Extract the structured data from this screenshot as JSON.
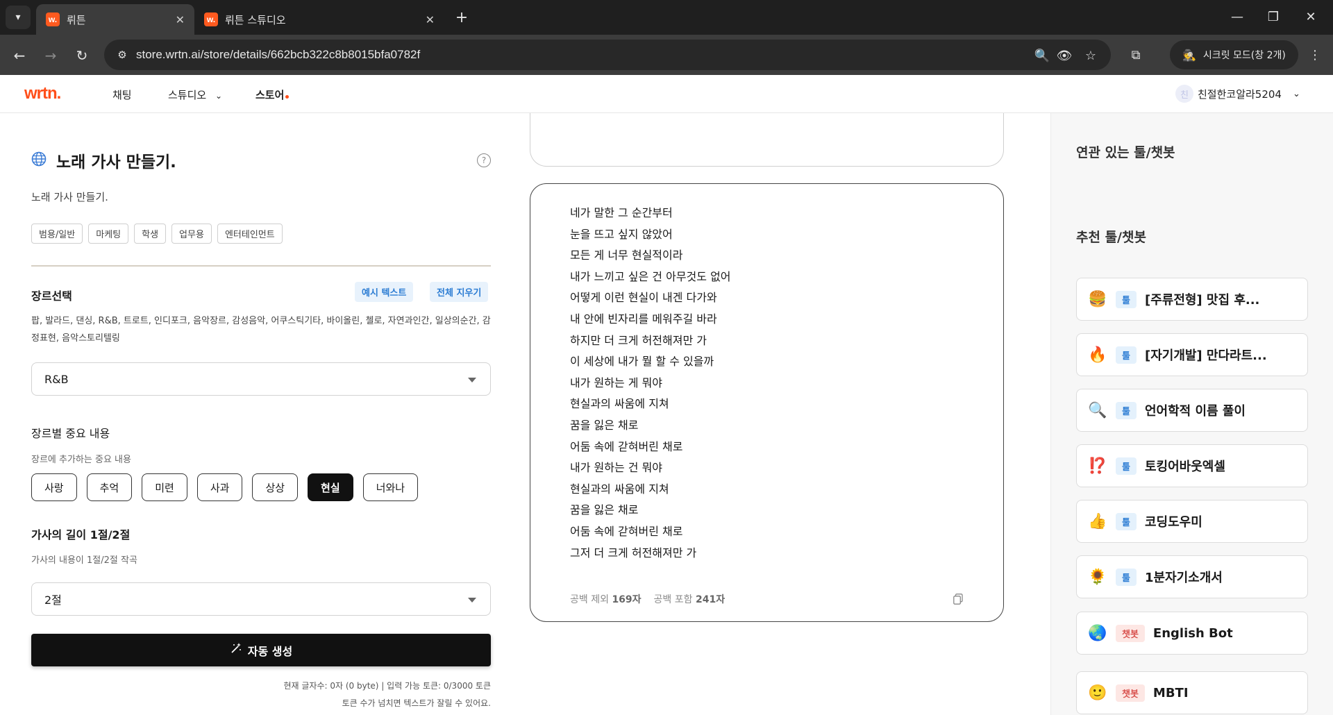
{
  "browser": {
    "tabs": [
      {
        "title": "뤼튼",
        "favicon": "w."
      },
      {
        "title": "뤼튼 스튜디오",
        "favicon": "w."
      }
    ],
    "url": "store.wrtn.ai/store/details/662bcb322c8b8015bfa0782f",
    "incognito_label": "시크릿 모드(창 2개)",
    "icons": {
      "tab_menu": "▾",
      "close": "✕",
      "new_tab": "+",
      "minimize": "—",
      "maximize": "❐",
      "win_close": "✕",
      "back": "←",
      "forward": "→",
      "reload": "↻",
      "site_info": "⚙",
      "zoom": "🔍",
      "eye_off": "👁",
      "star": "☆",
      "extensions": "⧉",
      "more": "⋮",
      "incognito": "🕵"
    }
  },
  "site": {
    "logo": "wrtn.",
    "nav": {
      "chat": "채팅",
      "studio": "스튜디오",
      "studio_caret": "⌄",
      "store": "스토어"
    },
    "user": {
      "avatar": "친",
      "name": "친절한코알라5204",
      "caret": "⌄"
    }
  },
  "tool": {
    "title": "노래 가사 만들기.",
    "description": "노래 가사 만들기.",
    "help": "?",
    "tags": [
      "범용/일반",
      "마케팅",
      "학생",
      "업무용",
      "엔터테인먼트"
    ]
  },
  "form": {
    "genre": {
      "label": "장르선택",
      "example_button": "예시 텍스트",
      "clear_button": "전체 지우기",
      "options_text": "팝, 발라드, 댄싱, R&B, 트로트, 인디포크, 음악장르, 감성음악, 어쿠스틱기타, 바이올린, 첼로, 자연과인간, 일상의순간, 감정표현, 음악스토리텔링",
      "selected": "R&B"
    },
    "content": {
      "label": "장르별 중요 내용",
      "sub": "장르에 추가하는 중요 내용",
      "chips": [
        "사랑",
        "추억",
        "미련",
        "사과",
        "상상",
        "현실",
        "너와나"
      ],
      "selected": "현실"
    },
    "length": {
      "label": "가사의 길이 1절/2절",
      "sub": "가사의 내용이 1절/2절 작곡",
      "selected": "2절"
    },
    "generate_button": "자동 생성",
    "count_line1": "현재 글자수: 0자 (0 byte)  |  입력 가능 토큰: 0/3000 토큰",
    "count_line2": "토큰 수가 넘치면 텍스트가 잘릴 수 있어요."
  },
  "result": {
    "lyrics": [
      "네가 말한 그 순간부터",
      "눈을 뜨고 싶지 않았어",
      "모든 게 너무 현실적이라",
      "내가 느끼고 싶은 건 아무것도 없어",
      "어떻게 이런 현실이 내겐 다가와",
      "내 안에 빈자리를 메워주길 바라",
      "하지만 더 크게 허전해져만 가",
      "이 세상에 내가 뭘 할 수 있을까",
      "내가 원하는 게 뭐야",
      "현실과의 싸움에 지쳐",
      "꿈을 잃은 채로",
      "어둠 속에 갇혀버린 채로",
      "내가 원하는 건 뭐야",
      "현실과의 싸움에 지쳐",
      "꿈을 잃은 채로",
      "어둠 속에 갇혀버린 채로",
      "그저 더 크게 허전해져만 가"
    ],
    "stats": {
      "no_space_label": "공백 제외",
      "no_space_value": "169자",
      "with_space_label": "공백 포함",
      "with_space_value": "241자"
    }
  },
  "sidebar": {
    "related_heading": "연관 있는 툴/챗봇",
    "recommended_heading": "추천 툴/챗봇",
    "items": [
      {
        "emoji": "🍔",
        "badge": "툴",
        "type": "tool",
        "name": "[주류전형] 맛집 후..."
      },
      {
        "emoji": "🔥",
        "badge": "툴",
        "type": "tool",
        "name": "[자기개발] 만다라트..."
      },
      {
        "emoji": "🔍",
        "badge": "툴",
        "type": "tool",
        "name": "언어학적 이름 풀이"
      },
      {
        "emoji": "⁉️",
        "badge": "툴",
        "type": "tool",
        "name": "토킹어바웃엑셀"
      },
      {
        "emoji": "👍",
        "badge": "툴",
        "type": "tool",
        "name": "코딩도우미"
      },
      {
        "emoji": "🌻",
        "badge": "툴",
        "type": "tool",
        "name": "1분자기소개서"
      },
      {
        "emoji": "🌏",
        "badge": "챗봇",
        "type": "bot",
        "name": "English Bot"
      },
      {
        "emoji": "🙂",
        "badge": "챗봇",
        "type": "bot",
        "name": "MBTI"
      }
    ]
  }
}
